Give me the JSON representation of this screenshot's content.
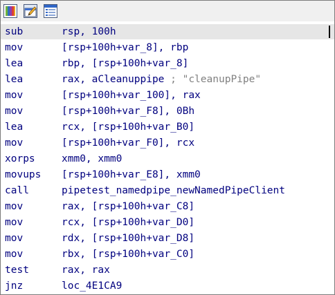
{
  "window": {
    "toolbar": {
      "icons": [
        "graph-view-icon",
        "edit-function-icon",
        "properties-icon"
      ]
    }
  },
  "colors": {
    "instruction_text": "#00007f",
    "comment_text": "#808080",
    "current_line_bg": "#e6e6e6",
    "border": "#7a7a7a"
  },
  "listing": {
    "lines": [
      {
        "mnemonic": "sub",
        "operands": "rsp, 100h",
        "comment": ""
      },
      {
        "mnemonic": "mov",
        "operands": "[rsp+100h+var_8], rbp",
        "comment": ""
      },
      {
        "mnemonic": "lea",
        "operands": "rbp, [rsp+100h+var_8]",
        "comment": ""
      },
      {
        "mnemonic": "lea",
        "operands": "rax, aCleanuppipe",
        "comment": "; \"cleanupPipe\""
      },
      {
        "mnemonic": "mov",
        "operands": "[rsp+100h+var_100], rax",
        "comment": ""
      },
      {
        "mnemonic": "mov",
        "operands": "[rsp+100h+var_F8], 0Bh",
        "comment": ""
      },
      {
        "mnemonic": "lea",
        "operands": "rcx, [rsp+100h+var_B0]",
        "comment": ""
      },
      {
        "mnemonic": "mov",
        "operands": "[rsp+100h+var_F0], rcx",
        "comment": ""
      },
      {
        "mnemonic": "xorps",
        "operands": "xmm0, xmm0",
        "comment": ""
      },
      {
        "mnemonic": "movups",
        "operands": "[rsp+100h+var_E8], xmm0",
        "comment": ""
      },
      {
        "mnemonic": "call",
        "operands": "pipetest_namedpipe_newNamedPipeClient",
        "comment": ""
      },
      {
        "mnemonic": "mov",
        "operands": "rax, [rsp+100h+var_C8]",
        "comment": ""
      },
      {
        "mnemonic": "mov",
        "operands": "rcx, [rsp+100h+var_D0]",
        "comment": ""
      },
      {
        "mnemonic": "mov",
        "operands": "rdx, [rsp+100h+var_D8]",
        "comment": ""
      },
      {
        "mnemonic": "mov",
        "operands": "rbx, [rsp+100h+var_C0]",
        "comment": ""
      },
      {
        "mnemonic": "test",
        "operands": "rax, rax",
        "comment": ""
      },
      {
        "mnemonic": "jnz",
        "operands": "loc_4E1CA9",
        "comment": ""
      }
    ]
  }
}
